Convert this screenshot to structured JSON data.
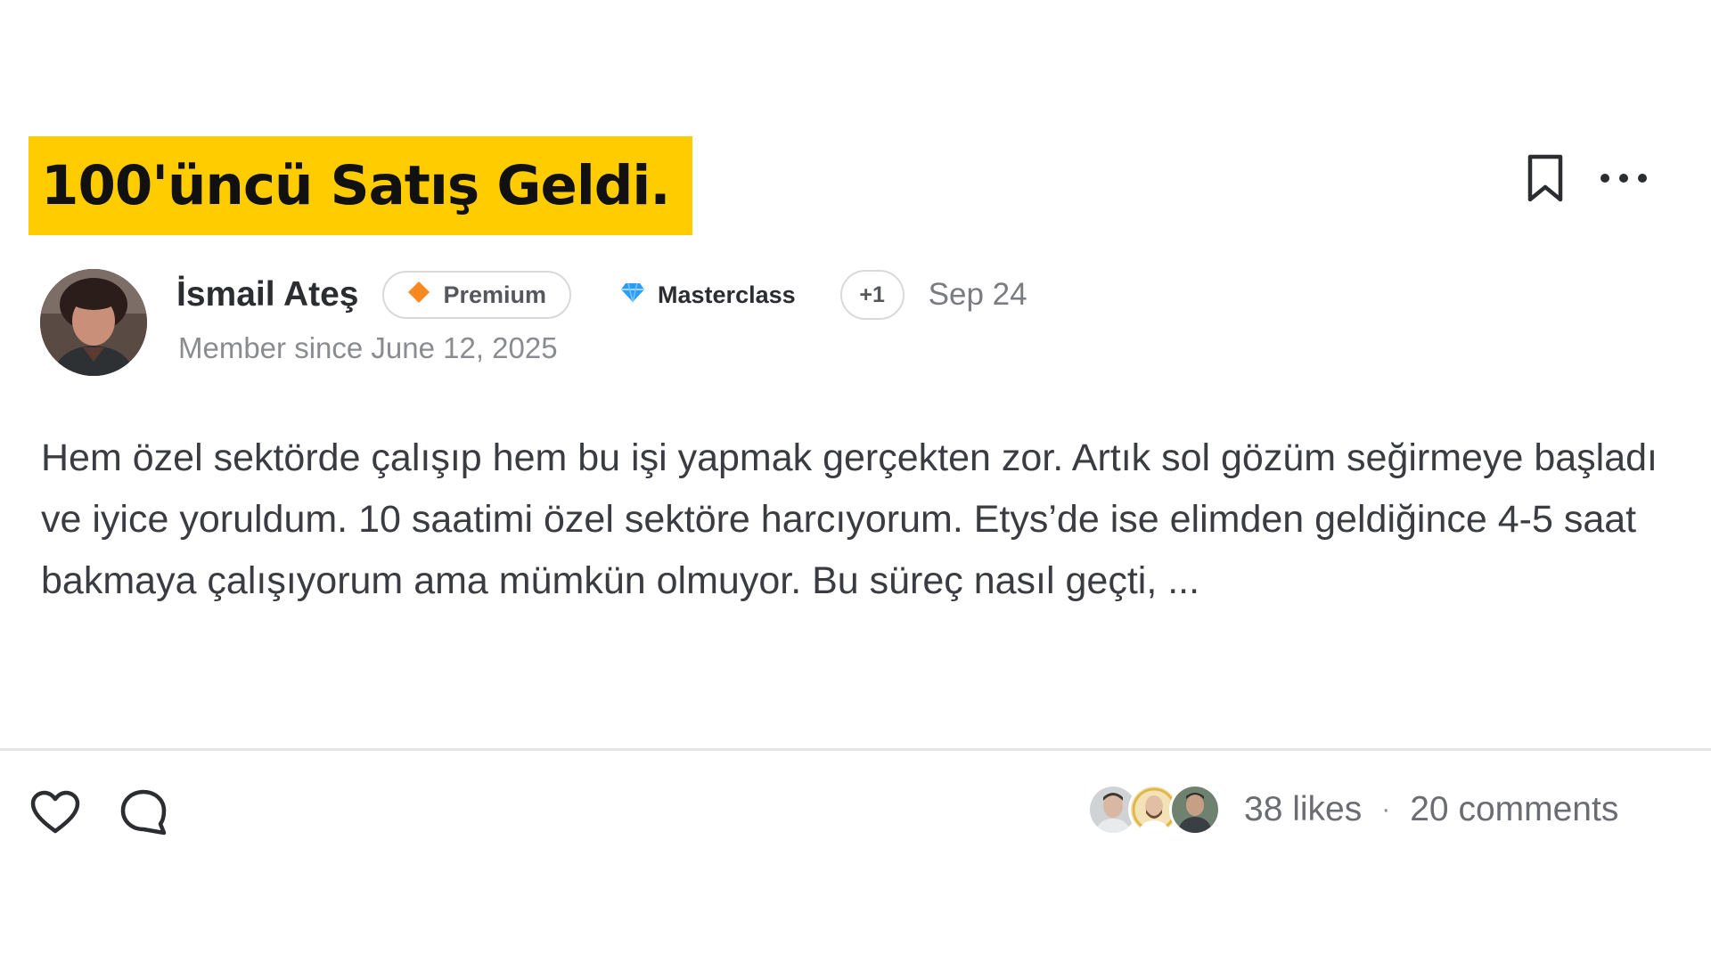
{
  "post": {
    "title": "100'üncü Satış Geldi.",
    "author": {
      "name": "İsmail Ateş",
      "member_since": "Member since June 12, 2025"
    },
    "badges": {
      "premium_label": "Premium",
      "masterclass_label": "Masterclass",
      "more_label": "+1"
    },
    "date": "Sep 24",
    "body": "Hem özel sektörde çalışıp hem bu işi yapmak gerçekten zor. Artık sol gözüm seğirmeye başladı ve iyice yoruldum. 10 saatimi özel sektöre harcıyorum. Etys’de ise elimden geldiğince 4-5 saat bakmaya çalışıyorum ama mümkün olmuyor. Bu süreç nasıl geçti, ...",
    "stats": {
      "likes": "38 likes",
      "separator": "·",
      "comments": "20 comments"
    }
  },
  "icons": {
    "bookmark": "bookmark-icon",
    "more": "more-horizontal-icon",
    "like": "heart-icon",
    "comment": "comment-icon",
    "premium": "diamond-orange-icon",
    "masterclass": "gem-blue-icon"
  },
  "colors": {
    "title_highlight": "#ffcc00",
    "premium_diamond": "#f5891f",
    "masterclass_gem": "#2a9df4",
    "divider": "#e3e4e7"
  }
}
